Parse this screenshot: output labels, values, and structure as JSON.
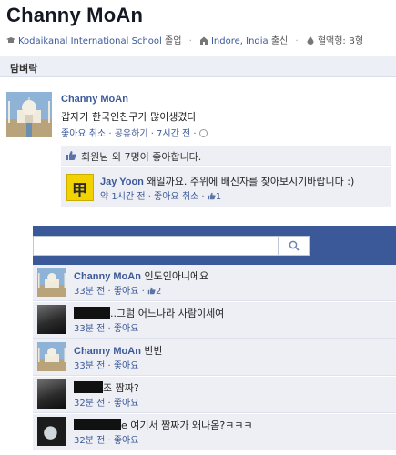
{
  "profile": {
    "name": "Channy MoAn",
    "school": "Kodaikanal International School",
    "school_suffix": "졸업",
    "hometown": "Indore, India",
    "hometown_suffix": "출신",
    "blood_type": "혈액형: B형"
  },
  "section": {
    "title": "담벼락"
  },
  "post": {
    "author": "Channy MoAn",
    "text": "갑자기 한국인친구가 많이생겼다",
    "actions": "좋아요 취소 · 공유하기 · 7시간 전 · ",
    "likes_text": "회원님 외 7명이 좋아합니다.",
    "comment": {
      "author": "Jay Yoon",
      "avatar_char": "甲",
      "text": "왜일까요. 주위에 배신자를 찾아보시기바랍니다 :)",
      "meta": "약 1시간 전 · 좋아요 취소 · ",
      "likes": "1"
    }
  },
  "thread": {
    "comments": [
      {
        "author": "Channy MoAn",
        "text": "인도인아니에요",
        "meta": "33분 전 · 좋아요 · ",
        "likes": "2",
        "avatar": "taj"
      },
      {
        "author": "",
        "text": "..그럼 어느나라 사람이세여",
        "meta": "33분 전 · 좋아요",
        "avatar": "dark"
      },
      {
        "author": "Channy MoAn",
        "text": "반반",
        "meta": "33분 전 · 좋아요",
        "avatar": "taj"
      },
      {
        "author": "",
        "text": "조 짬짜?",
        "meta": "32분 전 · 좋아요",
        "avatar": "dark"
      },
      {
        "author": "",
        "text": "e 여기서 짬짜가 왜나옴?ㅋㅋㅋ",
        "meta": "32분 전 · 좋아요",
        "avatar": "moon"
      }
    ]
  },
  "colors": {
    "fb_blue": "#3b5998",
    "comment_bg": "#edeff4",
    "link": "#3b5998"
  }
}
